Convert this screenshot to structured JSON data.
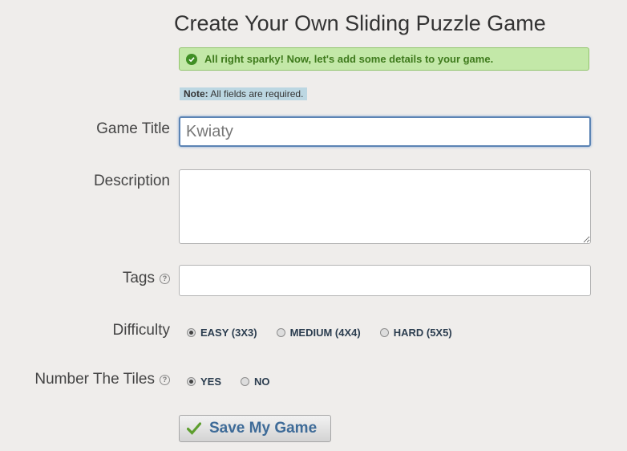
{
  "page_title": "Create Your Own Sliding Puzzle Game",
  "alert": {
    "icon": "check-circle-icon",
    "message": "All right sparky! Now, let's add some details to your game.",
    "color": "#3e7a1c",
    "background": "#c3e8a8"
  },
  "note": {
    "label": "Note:",
    "text": " All fields are required."
  },
  "form": {
    "game_title": {
      "label": "Game Title",
      "value": "Kwiaty"
    },
    "description": {
      "label": "Description",
      "value": ""
    },
    "tags": {
      "label": "Tags",
      "help_icon": "question-icon",
      "help_glyph": "?",
      "value": ""
    },
    "difficulty": {
      "label": "Difficulty",
      "options": [
        {
          "label": "EASY (3X3)",
          "checked": true
        },
        {
          "label": "MEDIUM (4X4)",
          "checked": false
        },
        {
          "label": "HARD (5X5)",
          "checked": false
        }
      ]
    },
    "number_tiles": {
      "label": "Number The Tiles",
      "help_icon": "question-icon",
      "help_glyph": "?",
      "options": [
        {
          "label": "YES",
          "checked": true
        },
        {
          "label": "NO",
          "checked": false
        }
      ]
    }
  },
  "save_button": {
    "label": "Save My Game",
    "icon": "checkmark-icon",
    "color": "#3e6b98"
  }
}
